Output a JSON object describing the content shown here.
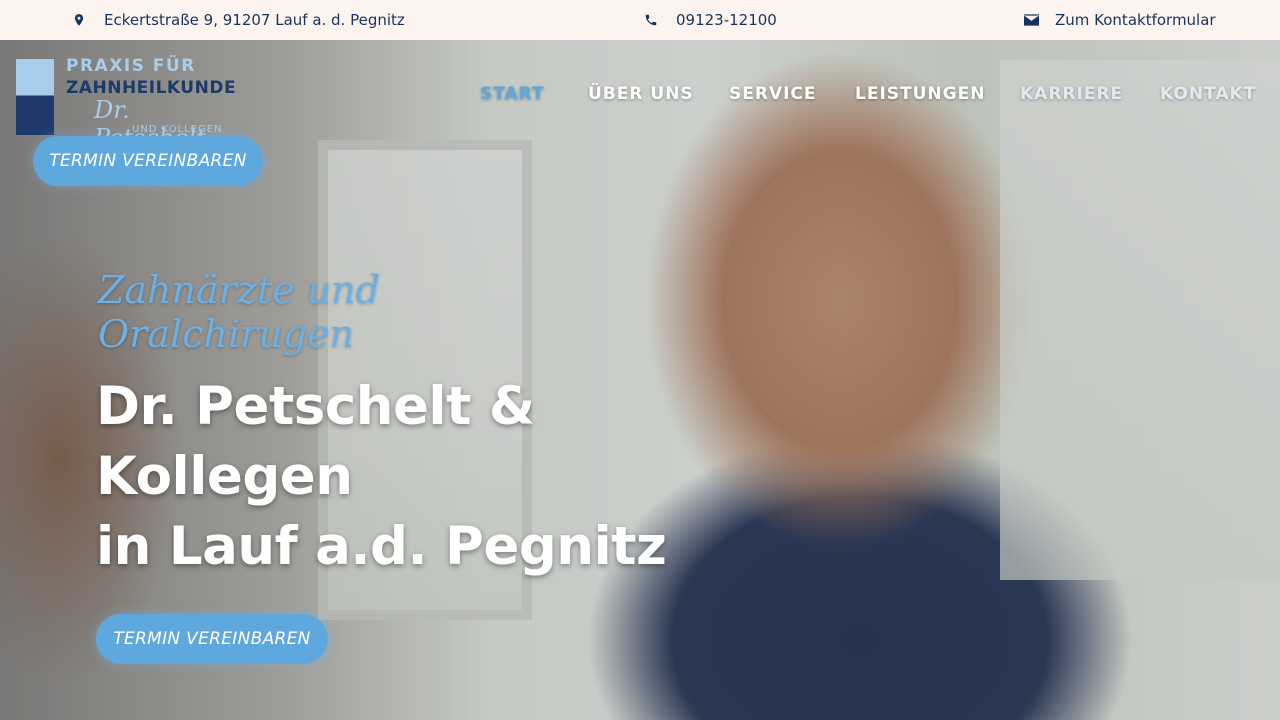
{
  "topbar": {
    "address": "Eckertstraße 9, 91207 Lauf a. d. Pegnitz",
    "phone": "09123-12100",
    "contact_link": "Zum Kontaktformular",
    "icons": [
      "location-pin-icon",
      "phone-icon",
      "envelope-icon"
    ]
  },
  "logo": {
    "line1": "PRAXIS FÜR",
    "line2": "ZAHNHEILKUNDE",
    "line3": "Dr. Petschelt",
    "line4": "UND KOLLEGEN"
  },
  "header": {
    "cta_label": "TERMIN VEREINBAREN"
  },
  "nav": {
    "items": [
      {
        "label": "START",
        "active": true
      },
      {
        "label": "ÜBER UNS",
        "active": false
      },
      {
        "label": "SERVICE",
        "active": false
      },
      {
        "label": "LEISTUNGEN",
        "active": false
      },
      {
        "label": "KARRIERE",
        "active": false
      },
      {
        "label": "KONTAKT",
        "active": false
      }
    ]
  },
  "hero": {
    "script_line1": "Zahnärzte und",
    "script_line2": "Oralchirugen",
    "title_line1": "Dr. Petschelt &",
    "title_line2": "Kollegen",
    "title_line3": "in Lauf a.d. Pegnitz",
    "cta_label": "TERMIN VEREINBAREN"
  },
  "colors": {
    "accent": "#5fa8dd",
    "navy": "#17345e",
    "topbar_bg": "#fdf4ef"
  }
}
